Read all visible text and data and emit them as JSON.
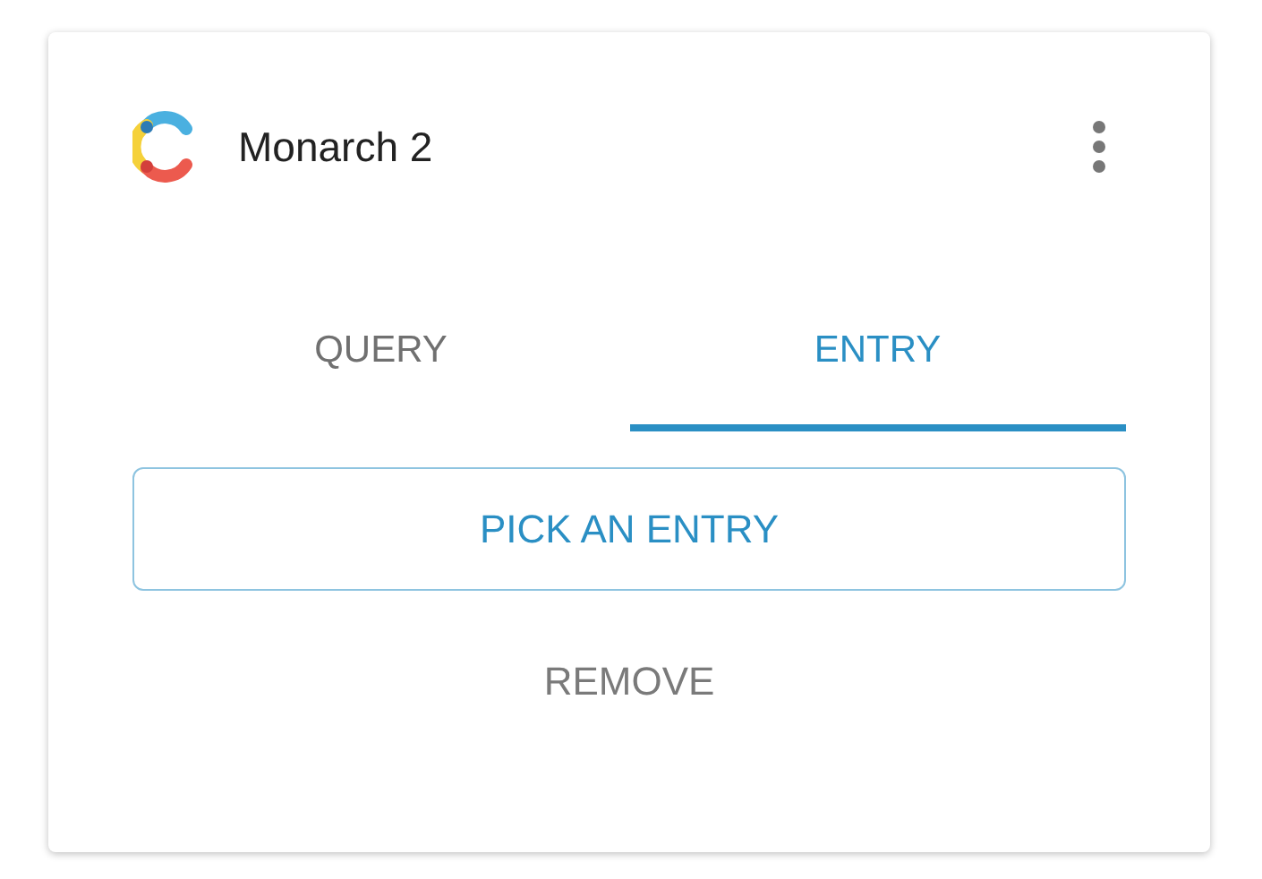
{
  "card": {
    "title": "Monarch 2"
  },
  "tabs": [
    {
      "label": "QUERY",
      "selected": false
    },
    {
      "label": "ENTRY",
      "selected": true
    }
  ],
  "pick_button": {
    "label": "PICK AN ENTRY"
  },
  "remove_button": {
    "label": "REMOVE"
  }
}
